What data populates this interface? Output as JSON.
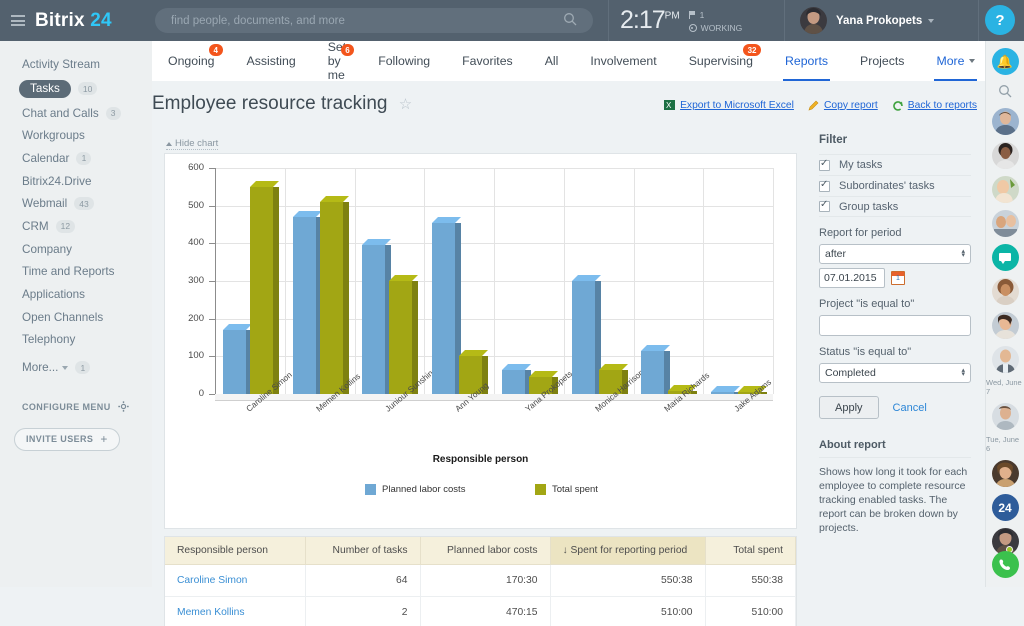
{
  "header": {
    "logo_primary": "Bitrix",
    "logo_secondary": "24",
    "search_placeholder": "find people, documents, and more",
    "search_value": "",
    "clock_time": "2:17",
    "clock_meridiem": "PM",
    "flag_count": "1",
    "status_text": "WORKING",
    "user_name": "Yana Prokopets",
    "help_label": "?"
  },
  "sidebar": {
    "items": [
      {
        "label": "Activity Stream",
        "badge": "",
        "active": false
      },
      {
        "label": "Tasks",
        "badge": "10",
        "active": true
      },
      {
        "label": "Chat and Calls",
        "badge": "3",
        "active": false
      },
      {
        "label": "Workgroups",
        "badge": "",
        "active": false
      },
      {
        "label": "Calendar",
        "badge": "1",
        "active": false
      },
      {
        "label": "Bitrix24.Drive",
        "badge": "",
        "active": false
      },
      {
        "label": "Webmail",
        "badge": "43",
        "active": false
      },
      {
        "label": "CRM",
        "badge": "12",
        "active": false
      },
      {
        "label": "Company",
        "badge": "",
        "active": false
      },
      {
        "label": "Time and Reports",
        "badge": "",
        "active": false
      },
      {
        "label": "Applications",
        "badge": "",
        "active": false
      },
      {
        "label": "Open Channels",
        "badge": "",
        "active": false
      },
      {
        "label": "Telephony",
        "badge": "",
        "active": false
      }
    ],
    "more_label": "More...",
    "more_badge": "1",
    "configure_menu": "CONFIGURE MENU",
    "invite_users": "INVITE USERS"
  },
  "tabs": [
    {
      "label": "Ongoing",
      "badge": "4",
      "selected": false
    },
    {
      "label": "Assisting",
      "badge": "",
      "selected": false
    },
    {
      "label": "Set by me",
      "badge": "6",
      "selected": false
    },
    {
      "label": "Following",
      "badge": "",
      "selected": false
    },
    {
      "label": "Favorites",
      "badge": "",
      "selected": false
    },
    {
      "label": "All",
      "badge": "",
      "selected": false
    },
    {
      "label": "Involvement",
      "badge": "",
      "selected": false
    },
    {
      "label": "Supervising",
      "badge": "32",
      "selected": false
    },
    {
      "label": "Reports",
      "badge": "",
      "selected": true
    },
    {
      "label": "Projects",
      "badge": "",
      "selected": false
    },
    {
      "label": "More",
      "badge": "",
      "selected": true,
      "caret": true
    }
  ],
  "page": {
    "title": "Employee resource tracking",
    "star": "☆",
    "links": [
      {
        "label": "Export to Microsoft Excel",
        "icon": "excel-icon"
      },
      {
        "label": "Copy report",
        "icon": "pencil-icon"
      },
      {
        "label": "Back to reports",
        "icon": "back-arrow-icon"
      }
    ],
    "hide_chart": "Hide chart"
  },
  "chart_data": {
    "type": "bar",
    "title": "",
    "xlabel": "Responsible person",
    "ylabel": "",
    "ylim": [
      0,
      600
    ],
    "yticks": [
      0,
      100,
      200,
      300,
      400,
      500,
      600
    ],
    "grid": true,
    "legend_position": "bottom-left",
    "categories": [
      "Caroline Simon",
      "Memen Kollins",
      "Juniour Sunshine",
      "Ann Young",
      "Yana Prokopets",
      "Monica Harrison",
      "Maria Richards",
      "Jake Adams"
    ],
    "series": [
      {
        "name": "Planned labor costs",
        "color": "#6fa8d4",
        "values": [
          170,
          470,
          395,
          455,
          65,
          300,
          115,
          5
        ]
      },
      {
        "name": "Total spent",
        "color": "#a2a614",
        "values": [
          550,
          510,
          300,
          100,
          45,
          65,
          8,
          6
        ]
      }
    ]
  },
  "table": {
    "columns": [
      {
        "label": "Responsible person",
        "align": "left",
        "sorted": false
      },
      {
        "label": "Number of tasks",
        "align": "right",
        "sorted": false
      },
      {
        "label": "Planned labor costs",
        "align": "right",
        "sorted": false
      },
      {
        "label": "↓ Spent for reporting period",
        "align": "right",
        "sorted": true
      },
      {
        "label": "Total spent",
        "align": "right",
        "sorted": false
      }
    ],
    "rows": [
      [
        "Caroline Simon",
        "64",
        "170:30",
        "550:38",
        "550:38"
      ],
      [
        "Memen Kollins",
        "2",
        "470:15",
        "510:00",
        "510:00"
      ]
    ]
  },
  "filter": {
    "title": "Filter",
    "checkboxes": [
      {
        "label": "My tasks",
        "checked": true
      },
      {
        "label": "Subordinates' tasks",
        "checked": true
      },
      {
        "label": "Group tasks",
        "checked": true
      }
    ],
    "period_label": "Report for period",
    "period_value": "after",
    "date_value": "07.01.2015",
    "project_label": "Project \"is equal to\"",
    "project_value": "",
    "status_label": "Status \"is equal to\"",
    "status_value": "Completed",
    "apply_label": "Apply",
    "cancel_label": "Cancel",
    "about_title": "About report",
    "about_text": "Shows how long it took for each employee to complete resource tracking enabled tasks. The report can be broken down by projects."
  },
  "rail": {
    "date_1": "Wed, June 7",
    "date_2": "Tue, June 6",
    "b24_label": "24"
  },
  "colors": {
    "accent_blue": "#2066d6",
    "bar_blue": "#6fa8d4",
    "bar_olive": "#a2a614",
    "badge_red": "#f3551c",
    "header_bg": "#53616e"
  }
}
